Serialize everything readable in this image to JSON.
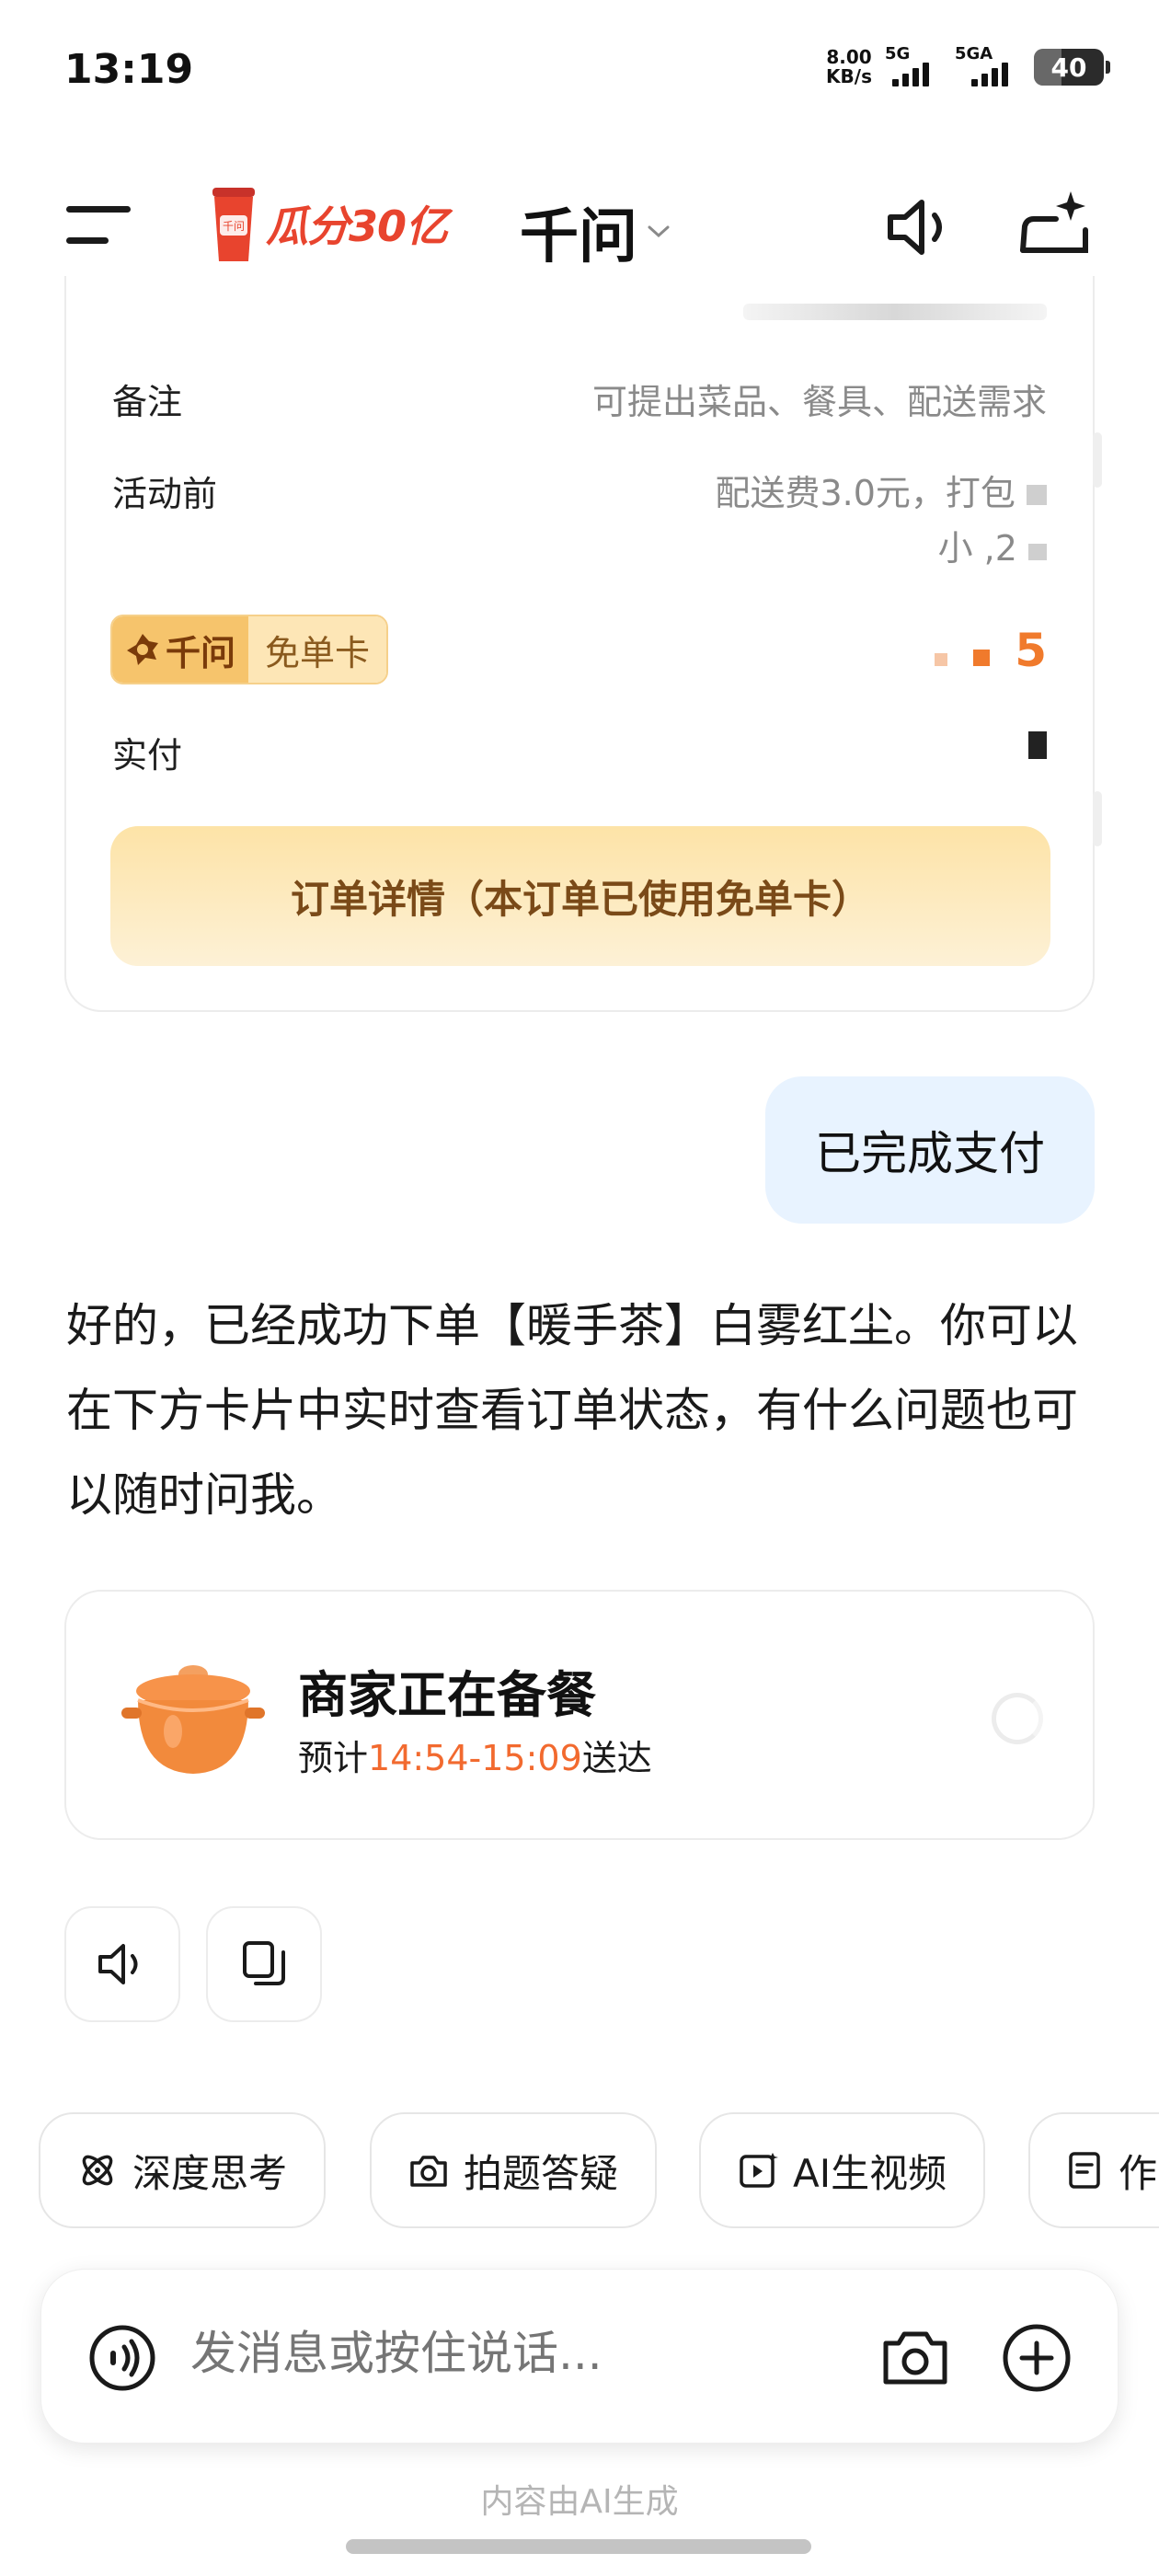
{
  "status_bar": {
    "time": "13:19",
    "net_speed_value": "8.00",
    "net_speed_unit": "KB/s",
    "sim1_label": "5G",
    "sim2_label": "5GA",
    "battery": "40",
    "battery_level": 0.4
  },
  "header": {
    "promo_text": "瓜分30亿",
    "app_title": "千问"
  },
  "order_card": {
    "remark_label": "备注",
    "remark_value": "可提出菜品、餐具、配送需求",
    "before_label": "活动前",
    "before_value_line1": "配送费3.0元，打包",
    "before_value_line2": "小    ,2",
    "badge_brand": "千问",
    "badge_text": "免单卡",
    "free_value": "5",
    "paid_label": "实付",
    "detail_button": "订单详情（本订单已使用免单卡）"
  },
  "chat": {
    "user_message": "已完成支付",
    "assistant_message": "好的，已经成功下单【暖手茶】白雾红尘。你可以在下方卡片中实时查看订单状态，有什么问题也可以随时问我。"
  },
  "status_card": {
    "title": "商家正在备餐",
    "eta_prefix": "预计",
    "eta_time": "14:54-15:09",
    "eta_suffix": "送达"
  },
  "chips": [
    {
      "label": "深度思考",
      "icon": "atom-icon"
    },
    {
      "label": "拍题答疑",
      "icon": "photo-question-icon"
    },
    {
      "label": "AI生视频",
      "icon": "video-spark-icon"
    },
    {
      "label": "作",
      "icon": "document-icon"
    }
  ],
  "input": {
    "placeholder": "发消息或按住说话..."
  },
  "footer_note": "内容由AI生成",
  "colors": {
    "accent_orange": "#f26a2f",
    "user_bubble": "#e8f3ff",
    "promo_red": "#e8442e"
  }
}
